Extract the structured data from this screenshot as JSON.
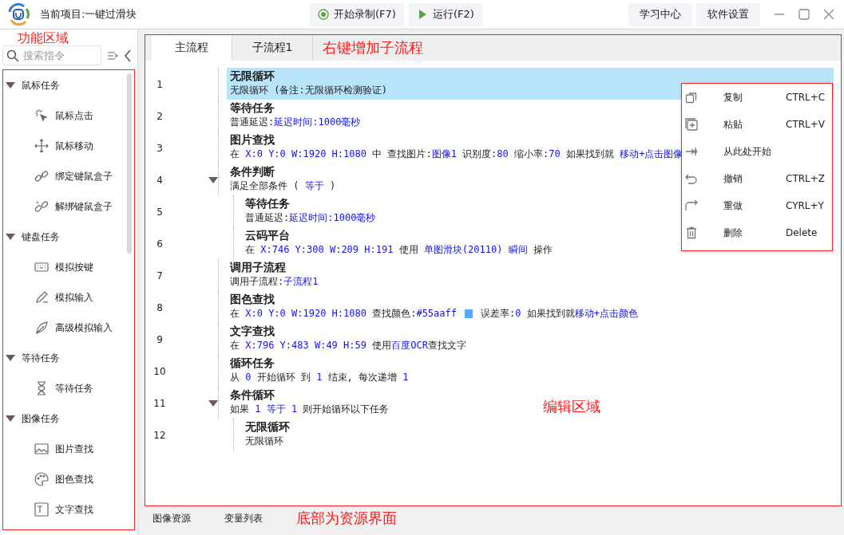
{
  "header": {
    "project_title": "当前项目:一键过滑块",
    "toolbar_buttons": [
      {
        "label": "开始录制(F7)"
      },
      {
        "label": "运行(F2)"
      }
    ],
    "header_buttons": [
      {
        "label": "学习中心"
      },
      {
        "label": "软件设置"
      }
    ]
  },
  "sidebar": {
    "search": {
      "placeholder": "搜索指令"
    },
    "groups": [
      {
        "label": "鼠标任务",
        "expanded": true,
        "items": [
          {
            "label": "鼠标点击"
          },
          {
            "label": "鼠标移动"
          },
          {
            "label": "绑定键鼠盒子"
          },
          {
            "label": "解绑键鼠盒子"
          }
        ]
      },
      {
        "label": "键盘任务",
        "expanded": true,
        "items": [
          {
            "label": "模拟按键"
          },
          {
            "label": "模拟输入"
          },
          {
            "label": "高级模拟输入"
          }
        ]
      },
      {
        "label": "等待任务",
        "expanded": true,
        "items": [
          {
            "label": "等待任务"
          }
        ]
      },
      {
        "label": "图像任务",
        "expanded": true,
        "items": [
          {
            "label": "图片查找"
          },
          {
            "label": "图色查找"
          },
          {
            "label": "文字查找"
          }
        ]
      }
    ]
  },
  "editor": {
    "tabs": [
      {
        "label": "主流程",
        "selected": true
      },
      {
        "label": "子流程1",
        "selected": false
      }
    ],
    "tasks": [
      {
        "number": "1",
        "title": "无限循环",
        "selected": true,
        "description": [
          {
            "kind": "text",
            "text": "无限循环 (备注:无限循环检测验证)"
          }
        ]
      },
      {
        "number": "2",
        "title": "等待任务",
        "selected": false,
        "description": [
          {
            "kind": "text",
            "text": "普通延迟:"
          },
          {
            "kind": "value",
            "text": "延迟时间:1000毫秒"
          }
        ]
      },
      {
        "number": "3",
        "title": "图片查找",
        "selected": false,
        "description": [
          {
            "kind": "text",
            "text": "在 "
          },
          {
            "kind": "value",
            "text": "X:0 Y:0 W:1920 H:1080"
          },
          {
            "kind": "text",
            "text": " 中 查找图片:"
          },
          {
            "kind": "value",
            "text": "图像1"
          },
          {
            "kind": "text",
            "text": " 识别度:"
          },
          {
            "kind": "value",
            "text": "80"
          },
          {
            "kind": "text",
            "text": " 缩小率:"
          },
          {
            "kind": "value",
            "text": "70"
          },
          {
            "kind": "text",
            "text": " 如果找到就 "
          },
          {
            "kind": "value",
            "text": "移动+点击图像"
          }
        ]
      },
      {
        "number": "4",
        "title": "条件判断",
        "selected": false,
        "expanded": true,
        "description": [
          {
            "kind": "text",
            "text": "满足全部条件 ( "
          },
          {
            "kind": "value",
            "text": "等于"
          },
          {
            "kind": "text",
            "text": " )"
          }
        ],
        "children": [
          {
            "number": "5",
            "title": "等待任务",
            "selected": false,
            "description": [
              {
                "kind": "text",
                "text": "普通延迟:"
              },
              {
                "kind": "value",
                "text": "延迟时间:1000毫秒"
              }
            ]
          },
          {
            "number": "6",
            "title": "云码平台",
            "selected": false,
            "description": [
              {
                "kind": "text",
                "text": "在 "
              },
              {
                "kind": "value",
                "text": "X:746 Y:300 W:209 H:191"
              },
              {
                "kind": "text",
                "text": " 使用 "
              },
              {
                "kind": "value",
                "text": "单图滑块(20110) 瞬间"
              },
              {
                "kind": "text",
                "text": " 操作"
              }
            ]
          }
        ]
      },
      {
        "number": "7",
        "title": "调用子流程",
        "selected": false,
        "description": [
          {
            "kind": "text",
            "text": "调用子流程:"
          },
          {
            "kind": "value",
            "text": "子流程1"
          }
        ]
      },
      {
        "number": "8",
        "title": "图色查找",
        "selected": false,
        "description": [
          {
            "kind": "text",
            "text": "在 "
          },
          {
            "kind": "value",
            "text": "X:0 Y:0 W:1920 H:1080"
          },
          {
            "kind": "text",
            "text": " 查找颜色:"
          },
          {
            "kind": "value",
            "text": "#55aaff"
          },
          {
            "kind": "swatch",
            "color": "#55aaff"
          },
          {
            "kind": "text",
            "text": "误差率:"
          },
          {
            "kind": "value",
            "text": "0"
          },
          {
            "kind": "text",
            "text": " 如果找到就"
          },
          {
            "kind": "value",
            "text": "移动+点击颜色"
          }
        ]
      },
      {
        "number": "9",
        "title": "文字查找",
        "selected": false,
        "description": [
          {
            "kind": "text",
            "text": "在 "
          },
          {
            "kind": "value",
            "text": "X:796 Y:483 W:49 H:59"
          },
          {
            "kind": "text",
            "text": " 使用"
          },
          {
            "kind": "value",
            "text": "百度OCR"
          },
          {
            "kind": "text",
            "text": "查找文字"
          }
        ]
      },
      {
        "number": "10",
        "title": "循环任务",
        "selected": false,
        "description": [
          {
            "kind": "text",
            "text": "从 "
          },
          {
            "kind": "value",
            "text": "0"
          },
          {
            "kind": "text",
            "text": " 开始循环 到 "
          },
          {
            "kind": "value",
            "text": "1"
          },
          {
            "kind": "text",
            "text": " 结束, 每次递增 "
          },
          {
            "kind": "value",
            "text": "1"
          }
        ]
      },
      {
        "number": "11",
        "title": "条件循环",
        "selected": false,
        "expanded": true,
        "description": [
          {
            "kind": "text",
            "text": "如果 "
          },
          {
            "kind": "value",
            "text": "1 等于 1"
          },
          {
            "kind": "text",
            "text": " 则开始循环以下任务"
          }
        ],
        "children": [
          {
            "number": "12",
            "title": "无限循环",
            "selected": false,
            "description": [
              {
                "kind": "text",
                "text": "无限循环"
              }
            ]
          }
        ]
      }
    ],
    "context_menu": [
      {
        "label": "复制",
        "shortcut": "CTRL+C"
      },
      {
        "label": "粘贴",
        "shortcut": "CTRL+V"
      },
      {
        "label": "从此处开始"
      },
      {
        "label": "撤销",
        "shortcut": "CTRL+Z"
      },
      {
        "label": "重做",
        "shortcut": "CYRL+Y"
      },
      {
        "label": "删除",
        "shortcut": "Delete"
      }
    ]
  },
  "bottom_tabs": [
    {
      "label": "图像资源"
    },
    {
      "label": "变量列表"
    }
  ],
  "annotations": {
    "sidebar": "功能区域",
    "tabs": "右键增加子流程",
    "editor": "编辑区域",
    "bottom": "底部为资源界面"
  }
}
